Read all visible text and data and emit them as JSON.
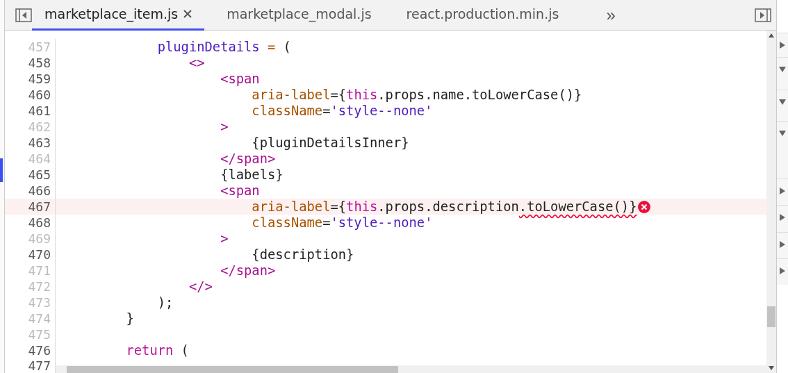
{
  "tabs": [
    {
      "label": "marketplace_item.js",
      "selected": true
    },
    {
      "label": "marketplace_modal.js",
      "selected": false
    },
    {
      "label": "react.production.min.js",
      "selected": false
    }
  ],
  "overflow": "»",
  "lines": [
    {
      "number": "457",
      "dim": true,
      "error": false,
      "tokens": [
        {
          "kind": "variable",
          "text": "            pluginDetails"
        },
        {
          "kind": "operator",
          "text": " = "
        },
        {
          "kind": "plain",
          "text": "("
        }
      ]
    },
    {
      "number": "458",
      "dim": false,
      "error": false,
      "tokens": [
        {
          "kind": "tag",
          "text": "                <>"
        }
      ]
    },
    {
      "number": "459",
      "dim": false,
      "error": false,
      "tokens": [
        {
          "kind": "tag",
          "text": "                    <span"
        }
      ]
    },
    {
      "number": "460",
      "dim": false,
      "error": false,
      "tokens": [
        {
          "kind": "attr",
          "text": "                        aria-label"
        },
        {
          "kind": "plain",
          "text": "={"
        },
        {
          "kind": "keyword",
          "text": "this"
        },
        {
          "kind": "plain",
          "text": ".props.name.toLowerCase()}"
        }
      ]
    },
    {
      "number": "461",
      "dim": false,
      "error": false,
      "tokens": [
        {
          "kind": "attr",
          "text": "                        className"
        },
        {
          "kind": "plain",
          "text": "="
        },
        {
          "kind": "string",
          "text": "'style--none'"
        }
      ]
    },
    {
      "number": "462",
      "dim": true,
      "error": false,
      "tokens": [
        {
          "kind": "tag",
          "text": "                    >"
        }
      ]
    },
    {
      "number": "463",
      "dim": false,
      "error": false,
      "tokens": [
        {
          "kind": "plain",
          "text": "                        {pluginDetailsInner}"
        }
      ]
    },
    {
      "number": "464",
      "dim": true,
      "error": false,
      "tokens": [
        {
          "kind": "tag",
          "text": "                    </span>"
        }
      ]
    },
    {
      "number": "465",
      "dim": false,
      "error": false,
      "tokens": [
        {
          "kind": "plain",
          "text": "                    {labels}"
        }
      ]
    },
    {
      "number": "466",
      "dim": false,
      "error": false,
      "tokens": [
        {
          "kind": "tag",
          "text": "                    <span"
        }
      ]
    },
    {
      "number": "467",
      "dim": false,
      "error": true,
      "tokens": [
        {
          "kind": "attr",
          "text": "                        aria-label"
        },
        {
          "kind": "plain",
          "text": "={"
        },
        {
          "kind": "keyword",
          "text": "this"
        },
        {
          "kind": "plain",
          "text": ".props.description"
        },
        {
          "kind": "squiggle",
          "text": ".toLowerCase()}"
        }
      ]
    },
    {
      "number": "468",
      "dim": false,
      "error": false,
      "tokens": [
        {
          "kind": "attr",
          "text": "                        className"
        },
        {
          "kind": "plain",
          "text": "="
        },
        {
          "kind": "string",
          "text": "'style--none'"
        }
      ]
    },
    {
      "number": "469",
      "dim": true,
      "error": false,
      "tokens": [
        {
          "kind": "tag",
          "text": "                    >"
        }
      ]
    },
    {
      "number": "470",
      "dim": false,
      "error": false,
      "tokens": [
        {
          "kind": "plain",
          "text": "                        {description}"
        }
      ]
    },
    {
      "number": "471",
      "dim": true,
      "error": false,
      "tokens": [
        {
          "kind": "tag",
          "text": "                    </span>"
        }
      ]
    },
    {
      "number": "472",
      "dim": true,
      "error": false,
      "tokens": [
        {
          "kind": "tag",
          "text": "                </>"
        }
      ]
    },
    {
      "number": "473",
      "dim": true,
      "error": false,
      "tokens": [
        {
          "kind": "plain",
          "text": "            );"
        }
      ]
    },
    {
      "number": "474",
      "dim": true,
      "error": false,
      "tokens": [
        {
          "kind": "plain",
          "text": "        }"
        }
      ]
    },
    {
      "number": "475",
      "dim": true,
      "error": false
    },
    {
      "number": "476",
      "dim": false,
      "error": false,
      "tokens": [
        {
          "kind": "keyword",
          "text": "        return"
        },
        {
          "kind": "plain",
          "text": " ("
        }
      ]
    },
    {
      "number": "477",
      "dim": false,
      "error": false
    }
  ],
  "sections": [
    {
      "expanded": false
    },
    {
      "expanded": true
    },
    {
      "expanded": true
    },
    {
      "expanded": true
    },
    {
      "expanded": false
    },
    {
      "expanded": false
    },
    {
      "expanded": false
    },
    {
      "expanded": false
    }
  ]
}
